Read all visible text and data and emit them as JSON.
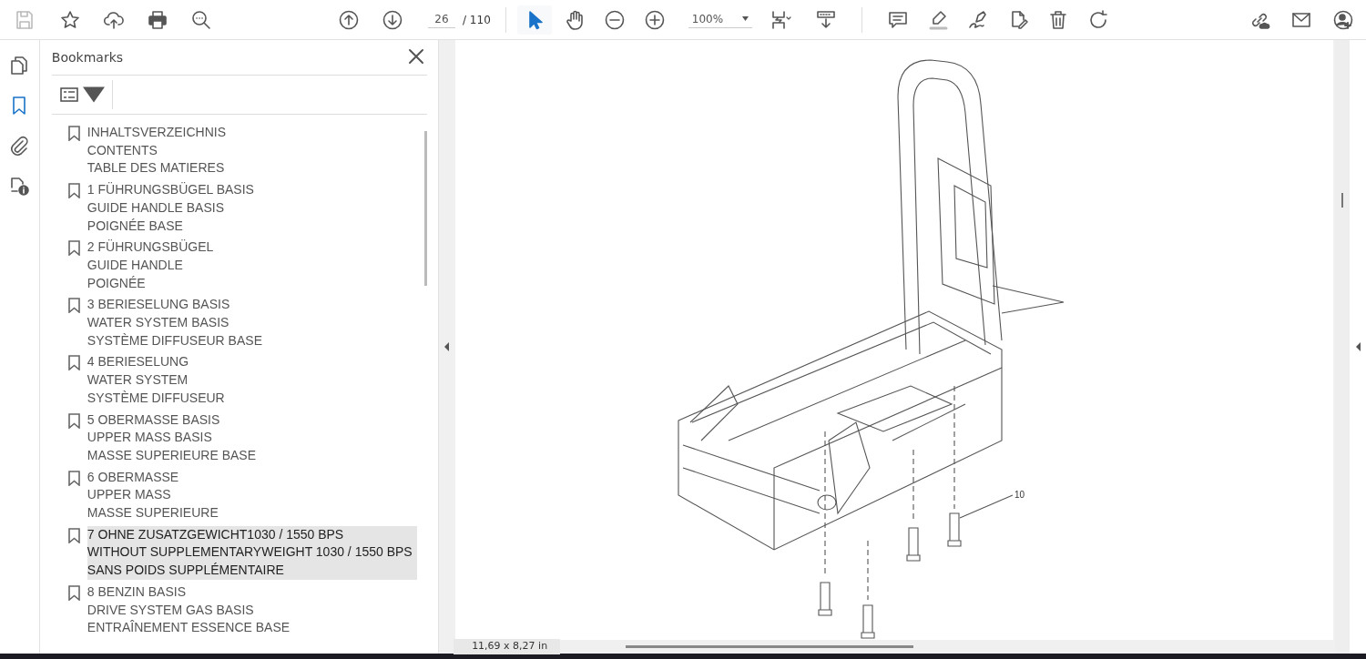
{
  "toolbar": {
    "save": {
      "disabled": true
    },
    "page": "26",
    "page_total": "/ 110",
    "zoom": "100%",
    "select_tool": {
      "selected": true
    },
    "hand_tool": {
      "selected": false
    }
  },
  "rail": [
    {
      "kind": "pages",
      "selected": false
    },
    {
      "kind": "bookmarks",
      "selected": true
    },
    {
      "kind": "attachments",
      "selected": false
    },
    {
      "kind": "info",
      "selected": false
    }
  ],
  "bookmarks": {
    "title": "Bookmarks",
    "items": [
      {
        "lines": [
          "INHALTSVERZEICHNIS",
          "CONTENTS",
          "TABLE DES MATIERES"
        ],
        "selected": false
      },
      {
        "lines": [
          "1 FÜHRUNGSBÜGEL BASIS",
          "GUIDE HANDLE BASIS",
          "POIGNÉE BASE"
        ],
        "selected": false
      },
      {
        "lines": [
          "2 FÜHRUNGSBÜGEL",
          "GUIDE HANDLE",
          "POIGNÉE"
        ],
        "selected": false
      },
      {
        "lines": [
          "3 BERIESELUNG BASIS",
          "WATER SYSTEM BASIS",
          "SYSTÈME DIFFUSEUR BASE"
        ],
        "selected": false
      },
      {
        "lines": [
          "4 BERIESELUNG",
          "WATER SYSTEM",
          "SYSTÈME DIFFUSEUR"
        ],
        "selected": false
      },
      {
        "lines": [
          "5 OBERMASSE BASIS",
          "UPPER MASS BASIS",
          "MASSE SUPERIEURE BASE"
        ],
        "selected": false
      },
      {
        "lines": [
          "6 OBERMASSE",
          "UPPER MASS",
          "MASSE SUPERIEURE"
        ],
        "selected": false
      },
      {
        "lines": [
          "7 OHNE ZUSATZGEWICHT1030 / 1550 BPS",
          "WITHOUT SUPPLEMENTARYWEIGHT 1030 / 1550 BPS",
          "SANS POIDS SUPPLÉMENTAIRE"
        ],
        "selected": true
      },
      {
        "lines": [
          "8 BENZIN BASIS",
          "DRIVE SYSTEM GAS BASIS",
          "ENTRAÎNEMENT ESSENCE BASE"
        ],
        "selected": false
      }
    ]
  },
  "document": {
    "callout": "10",
    "page_size": "11,69 x 8,27 in"
  }
}
